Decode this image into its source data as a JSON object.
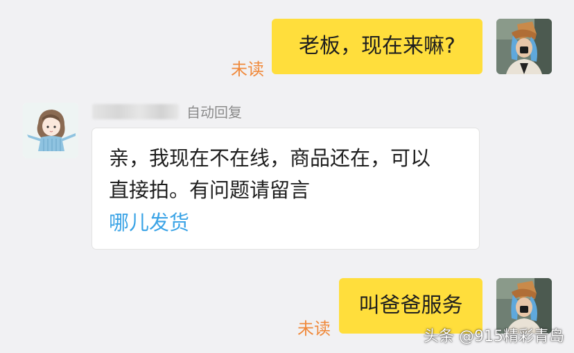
{
  "messages": {
    "out_1": {
      "text": "老板，现在来嘛?",
      "status": "未读"
    },
    "incoming": {
      "tag": "自动回复",
      "line1": "亲，我现在不在线，商品还在，可以",
      "line2": "直接拍。有问题请留言",
      "link": "哪儿发货"
    },
    "out_2": {
      "text": "叫爸爸服务",
      "status": "未读"
    }
  },
  "watermark": "头条 @915精彩青岛",
  "colors": {
    "background": "#f1f1f3",
    "outgoing_bubble": "#ffde3c",
    "unread_text": "#f08a3c",
    "link": "#3aa3e6"
  },
  "icons": {
    "self_avatar": "user-photo-avatar",
    "seller_avatar": "anime-girl-avatar"
  }
}
